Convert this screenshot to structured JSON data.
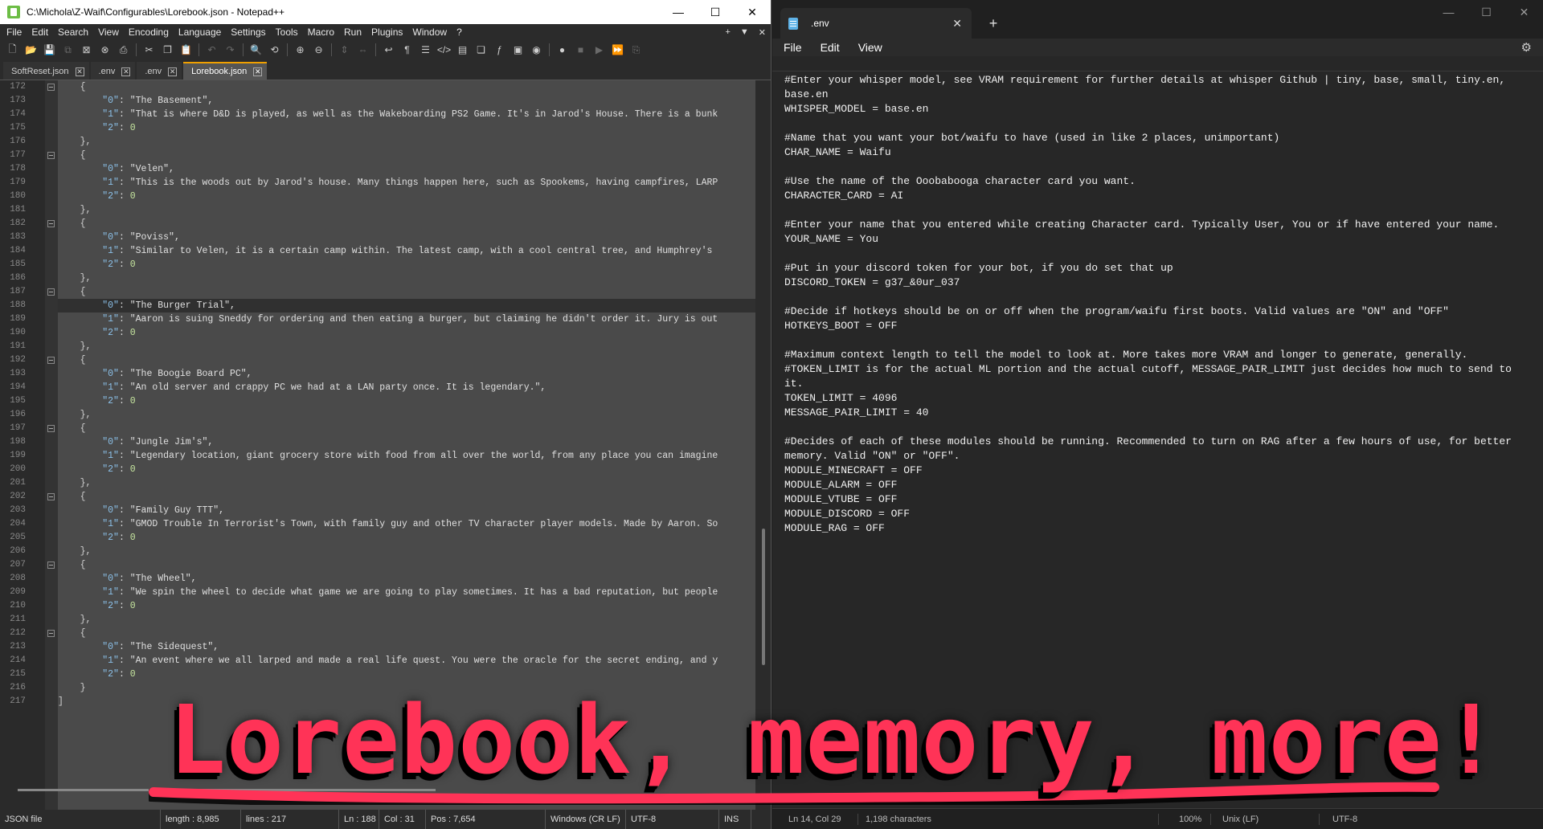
{
  "npp": {
    "title": "C:\\Michola\\Z-Waif\\Configurables\\Lorebook.json - Notepad++",
    "menu": [
      "File",
      "Edit",
      "Search",
      "View",
      "Encoding",
      "Language",
      "Settings",
      "Tools",
      "Macro",
      "Run",
      "Plugins",
      "Window",
      "?"
    ],
    "menu_right": [
      "+",
      "▼",
      "✕"
    ],
    "tabs": [
      {
        "label": "SoftReset.json",
        "active": false
      },
      {
        "label": ".env",
        "active": false
      },
      {
        "label": ".env",
        "active": false
      },
      {
        "label": "Lorebook.json",
        "active": true
      }
    ],
    "lines": [
      {
        "n": "172",
        "fold": true,
        "text": "    {"
      },
      {
        "n": "173",
        "text": "        \"0\": \"The Basement\","
      },
      {
        "n": "174",
        "text": "        \"1\": \"That is where D&D is played, as well as the Wakeboarding PS2 Game. It's in Jarod's House. There is a bunk"
      },
      {
        "n": "175",
        "text": "        \"2\": 0"
      },
      {
        "n": "176",
        "text": "    },"
      },
      {
        "n": "177",
        "fold": true,
        "text": "    {"
      },
      {
        "n": "178",
        "text": "        \"0\": \"Velen\","
      },
      {
        "n": "179",
        "text": "        \"1\": \"This is the woods out by Jarod's house. Many things happen here, such as Spookems, having campfires, LARP"
      },
      {
        "n": "180",
        "text": "        \"2\": 0"
      },
      {
        "n": "181",
        "text": "    },"
      },
      {
        "n": "182",
        "fold": true,
        "text": "    {"
      },
      {
        "n": "183",
        "text": "        \"0\": \"Poviss\","
      },
      {
        "n": "184",
        "text": "        \"1\": \"Similar to Velen, it is a certain camp within. The latest camp, with a cool central tree, and Humphrey's"
      },
      {
        "n": "185",
        "text": "        \"2\": 0"
      },
      {
        "n": "186",
        "text": "    },"
      },
      {
        "n": "187",
        "fold": true,
        "text": "    {"
      },
      {
        "n": "188",
        "current": true,
        "text": "        \"0\": \"The Burger Trial\","
      },
      {
        "n": "189",
        "text": "        \"1\": \"Aaron is suing Sneddy for ordering and then eating a burger, but claiming he didn't order it. Jury is out"
      },
      {
        "n": "190",
        "text": "        \"2\": 0"
      },
      {
        "n": "191",
        "text": "    },"
      },
      {
        "n": "192",
        "fold": true,
        "text": "    {"
      },
      {
        "n": "193",
        "text": "        \"0\": \"The Boogie Board PC\","
      },
      {
        "n": "194",
        "text": "        \"1\": \"An old server and crappy PC we had at a LAN party once. It is legendary.\","
      },
      {
        "n": "195",
        "text": "        \"2\": 0"
      },
      {
        "n": "196",
        "text": "    },"
      },
      {
        "n": "197",
        "fold": true,
        "text": "    {"
      },
      {
        "n": "198",
        "text": "        \"0\": \"Jungle Jim's\","
      },
      {
        "n": "199",
        "text": "        \"1\": \"Legendary location, giant grocery store with food from all over the world, from any place you can imagine"
      },
      {
        "n": "200",
        "text": "        \"2\": 0"
      },
      {
        "n": "201",
        "text": "    },"
      },
      {
        "n": "202",
        "fold": true,
        "text": "    {"
      },
      {
        "n": "203",
        "text": "        \"0\": \"Family Guy TTT\","
      },
      {
        "n": "204",
        "text": "        \"1\": \"GMOD Trouble In Terrorist's Town, with family guy and other TV character player models. Made by Aaron. So"
      },
      {
        "n": "205",
        "text": "        \"2\": 0"
      },
      {
        "n": "206",
        "text": "    },"
      },
      {
        "n": "207",
        "fold": true,
        "text": "    {"
      },
      {
        "n": "208",
        "text": "        \"0\": \"The Wheel\","
      },
      {
        "n": "209",
        "text": "        \"1\": \"We spin the wheel to decide what game we are going to play sometimes. It has a bad reputation, but people"
      },
      {
        "n": "210",
        "text": "        \"2\": 0"
      },
      {
        "n": "211",
        "text": "    },"
      },
      {
        "n": "212",
        "fold": true,
        "text": "    {"
      },
      {
        "n": "213",
        "text": "        \"0\": \"The Sidequest\","
      },
      {
        "n": "214",
        "text": "        \"1\": \"An event where we all larped and made a real life quest. You were the oracle for the secret ending, and y"
      },
      {
        "n": "215",
        "text": "        \"2\": 0"
      },
      {
        "n": "216",
        "text": "    }"
      },
      {
        "n": "217",
        "text": "]"
      }
    ],
    "status": {
      "filetype": "JSON file",
      "length": "length : 8,985",
      "lines": "lines : 217",
      "ln": "Ln : 188",
      "col": "Col : 31",
      "pos": "Pos : 7,654",
      "eol": "Windows (CR LF)",
      "encoding": "UTF-8",
      "mode": "INS"
    }
  },
  "notepad": {
    "tab_label": ".env",
    "menu": [
      "File",
      "Edit",
      "View"
    ],
    "lines": [
      "#Enter your whisper model, see VRAM requirement for further details at whisper Github | tiny, base, small, tiny.en,",
      "base.en",
      "WHISPER_MODEL = base.en",
      "",
      "#Name that you want your bot/waifu to have (used in like 2 places, unimportant)",
      "CHAR_NAME = Waifu",
      "",
      "#Use the name of the Ooobabooga character card you want.",
      "CHARACTER_CARD = AI",
      "",
      "#Enter your name that you entered while creating Character card. Typically User, You or if have entered your name.",
      "YOUR_NAME = You",
      "",
      "#Put in your discord token for your bot, if you do set that up",
      "DISCORD_TOKEN = g37_&0ur_037",
      "",
      "#Decide if hotkeys should be on or off when the program/waifu first boots. Valid values are \"ON\" and \"OFF\"",
      "HOTKEYS_BOOT = OFF",
      "",
      "#Maximum context length to tell the model to look at. More takes more VRAM and longer to generate, generally.",
      "#TOKEN_LIMIT is for the actual ML portion and the actual cutoff, MESSAGE_PAIR_LIMIT just decides how much to send to",
      "it.",
      "TOKEN_LIMIT = 4096",
      "MESSAGE_PAIR_LIMIT = 40",
      "",
      "#Decides of each of these modules should be running. Recommended to turn on RAG after a few hours of use, for better",
      "memory. Valid \"ON\" or \"OFF\".",
      "MODULE_MINECRAFT = OFF",
      "MODULE_ALARM = OFF",
      "MODULE_VTUBE = OFF",
      "MODULE_DISCORD = OFF",
      "MODULE_RAG = OFF"
    ],
    "status": {
      "position": "Ln 14, Col 29",
      "chars": "1,198 characters",
      "zoom": "100%",
      "eol": "Unix (LF)",
      "encoding": "UTF-8"
    }
  },
  "overlay": {
    "text": "Lorebook, memory, more!"
  },
  "colors": {
    "overlay_text": "#ff3357",
    "npp_active_tab_accent": "#f0a000"
  }
}
